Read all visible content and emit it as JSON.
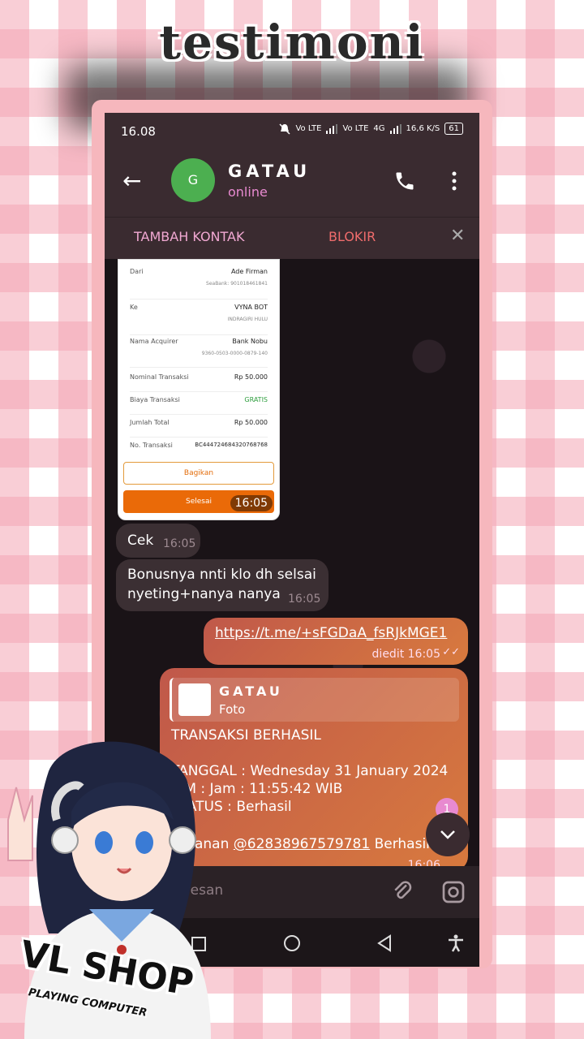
{
  "overlay": {
    "title": "testimoni",
    "logo": "VL SHOP",
    "logo_sub": "PLAYING COMPUTER"
  },
  "status_bar": {
    "time": "16.08",
    "net1": "Vo LTE",
    "net2": "Vo LTE",
    "net3": "4G",
    "speed": "16,6 K/S",
    "battery": "61"
  },
  "header": {
    "avatar_letter": "G",
    "name": "GATAU",
    "status": "online"
  },
  "action_bar": {
    "add_contact": "TAMBAH KONTAK",
    "block": "BLOKIR"
  },
  "receipt": {
    "rows": [
      {
        "label": "Dari",
        "value": "Ade Firman",
        "sub": "SeaBank: 901018461841"
      },
      {
        "label": "Ke",
        "value": "VYNA BOT",
        "sub": "INDRAGIRI HULU"
      },
      {
        "label": "Nama Acquirer",
        "value": "Bank Nobu",
        "sub": "9360-0503-0000-0879-140"
      },
      {
        "label": "Nominal Transaksi",
        "value": "Rp 50.000"
      },
      {
        "label": "Biaya Transaksi",
        "value": "GRATIS"
      },
      {
        "label": "Jumlah Total",
        "value": "Rp 50.000"
      },
      {
        "label": "No. Transaksi",
        "value": "BC444724684320768768"
      }
    ],
    "share_button": "Bagikan",
    "done_button": "Selesai",
    "time": "16:05"
  },
  "messages": [
    {
      "text": "Cek",
      "time": "16:05"
    },
    {
      "line1": "Bonusnya nnti klo dh selsai",
      "line2": "nyeting+nanya nanya",
      "time": "16:05"
    },
    {
      "text": "https://t.me/+sFGDaA_fsRJkMGE1",
      "meta": "diedit 16:05"
    },
    {
      "reply_name": "GATAU",
      "reply_type": "Foto",
      "line1": "TRANSAKSI BERHASIL",
      "line2": "TANGGAL : Wednesday 31 January 2024",
      "line3": "JAM : Jam : 11:55:42 WIB",
      "line4": "STATUS : Berhasil",
      "line5a": "Pesanan ",
      "mention": "@62838967579781",
      "line5b": " Berhasil",
      "time": "16:06"
    }
  ],
  "scroll_badge": "1",
  "input": {
    "placeholder": "Pesan"
  },
  "colors": {
    "accent": "#e88ad0",
    "bubble_out": "#c0584a",
    "frame": "#f6b7bd"
  }
}
